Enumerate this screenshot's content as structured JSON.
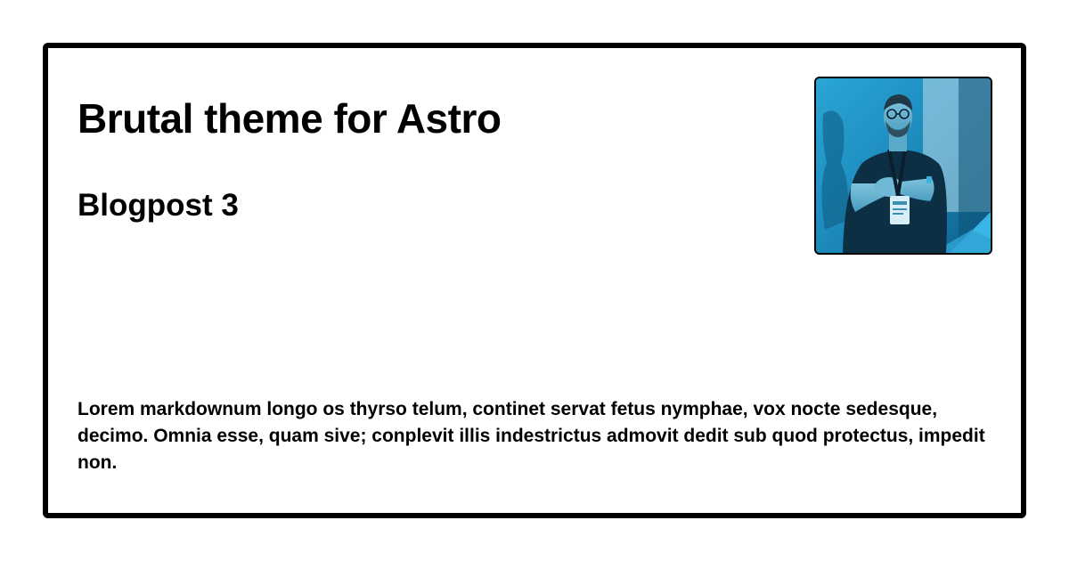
{
  "card": {
    "site_title": "Brutal theme for Astro",
    "post_title": "Blogpost 3",
    "excerpt": "Lorem markdownum longo os thyrso telum, continet servat fetus nymphae, vox nocte sedesque, decimo. Omnia esse, quam sive; conplevit illis indestrictus admovit dedit sub quod protectus, impedit non."
  },
  "colors": {
    "background": "#ffffff",
    "border": "#000000",
    "text": "#000000",
    "photo_tint": "#1a8fbf"
  }
}
